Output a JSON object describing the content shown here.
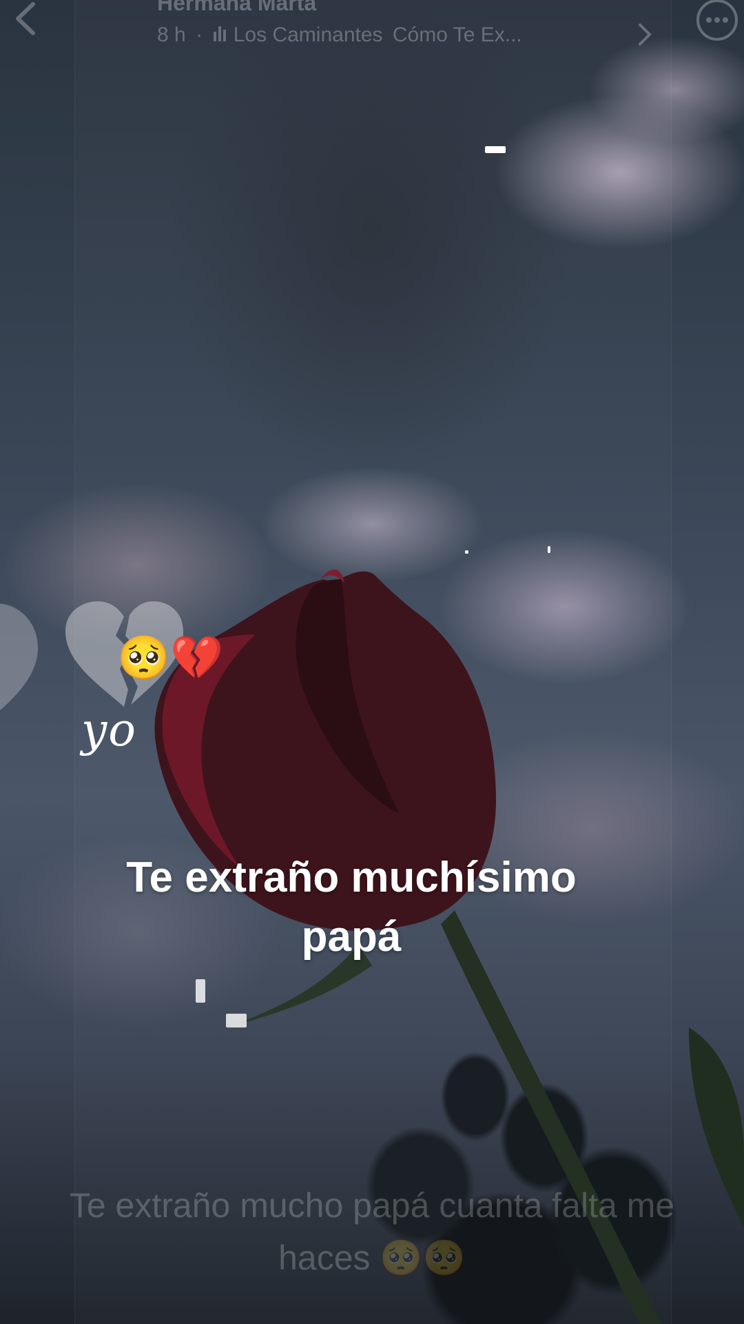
{
  "header": {
    "account_name": "Hermana Marta",
    "time_ago": "8 h",
    "dot": "·",
    "music_artist": "Los Caminantes",
    "music_song": "Cómo Te Ex..."
  },
  "icons": {
    "back": "chevron-left-icon",
    "music": "equalizer-icon",
    "next": "chevron-right-icon",
    "more": "more-horizontal-icon"
  },
  "sticker": {
    "emojis": "🥺💔",
    "handwritten": "yo"
  },
  "caption_overlay": {
    "line1": "Te extraño muchísimo",
    "line2": "papá"
  },
  "description": {
    "line1": "Te extraño mucho papá cuanta falta me",
    "line2": "haces 🥺🥺"
  },
  "colors": {
    "rose": "#5a0f1c",
    "stem": "#1e2d1c",
    "sky": "#3a4656"
  }
}
